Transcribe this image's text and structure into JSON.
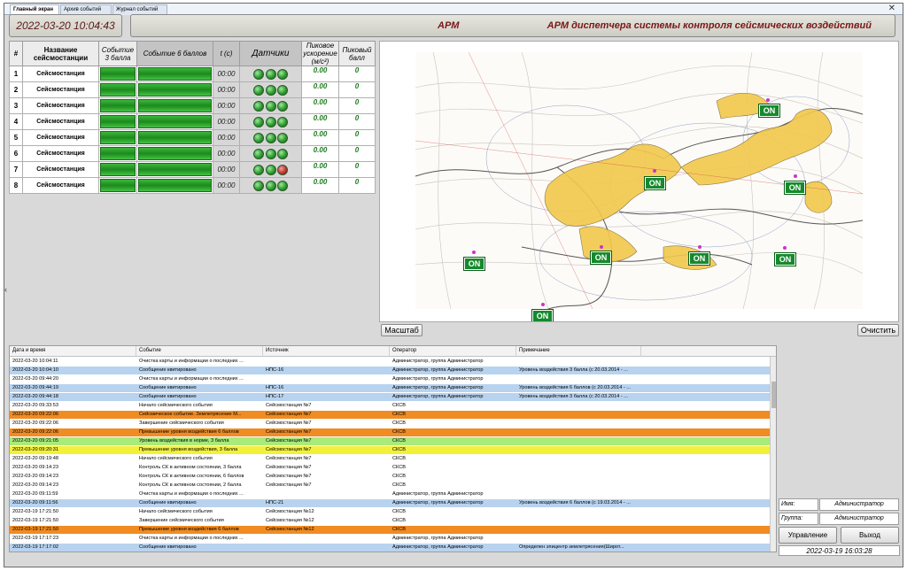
{
  "tabs": [
    "Главный экран",
    "Архив событий",
    "Журнал событий"
  ],
  "header": {
    "datetime": "2022-03-20 10:04:43",
    "left_label": "АРМ",
    "title": "АРМ диспетчера системы контроля сейсмических воздействий"
  },
  "stations_table": {
    "columns": {
      "num": "#",
      "name": "Название сейсмостанции",
      "event3": "Событие 3 балла",
      "event6": "Событие 6 баллов",
      "t": "t (с)",
      "sensors": "Датчики",
      "peak_accel": "Пиковое ускорение (м/с²)",
      "peak_score": "Пиковый балл"
    },
    "rows": [
      {
        "num": "1",
        "name": "Сейсмостанция",
        "t": "00:00",
        "sensors": [
          "green",
          "green",
          "green"
        ],
        "peak_accel": "0.00",
        "peak_score": "0"
      },
      {
        "num": "2",
        "name": "Сейсмостанция",
        "t": "00:00",
        "sensors": [
          "green",
          "green",
          "green"
        ],
        "peak_accel": "0.00",
        "peak_score": "0"
      },
      {
        "num": "3",
        "name": "Сейсмостанция",
        "t": "00:00",
        "sensors": [
          "green",
          "green",
          "green"
        ],
        "peak_accel": "0.00",
        "peak_score": "0"
      },
      {
        "num": "4",
        "name": "Сейсмостанция",
        "t": "00:00",
        "sensors": [
          "green",
          "green",
          "green"
        ],
        "peak_accel": "0.00",
        "peak_score": "0"
      },
      {
        "num": "5",
        "name": "Сейсмостанция",
        "t": "00:00",
        "sensors": [
          "green",
          "green",
          "green"
        ],
        "peak_accel": "0.00",
        "peak_score": "0"
      },
      {
        "num": "6",
        "name": "Сейсмостанция",
        "t": "00:00",
        "sensors": [
          "green",
          "green",
          "green"
        ],
        "peak_accel": "0.00",
        "peak_score": "0"
      },
      {
        "num": "7",
        "name": "Сейсмостанция",
        "t": "00:00",
        "sensors": [
          "green",
          "green",
          "red"
        ],
        "peak_accel": "0.00",
        "peak_score": "0"
      },
      {
        "num": "8",
        "name": "Сейсмостанция",
        "t": "00:00",
        "sensors": [
          "green",
          "green",
          "green"
        ],
        "peak_accel": "0.00",
        "peak_score": "0"
      }
    ]
  },
  "map": {
    "station_badge": "ON",
    "scale_button": "Масштаб",
    "clear_button": "Очистить"
  },
  "events": {
    "columns": [
      "Дата и время",
      "Событие",
      "Источник",
      "Оператор",
      "Примечание"
    ],
    "rows": [
      {
        "t": "2022-03-20 10:04:11",
        "ev": "Очистка карты и информации о последних ...",
        "src": "",
        "op": "Администратор, группа Администратор",
        "note": "",
        "color": "#ffffff"
      },
      {
        "t": "2022-03-20 10:04:10",
        "ev": "Сообщение квитировано",
        "src": "НПС-16",
        "op": "Администратор, группа Администратор",
        "note": "Уровень воздействия 3 балла (с 20.03.2014 - ...",
        "color": "#b8d3ef"
      },
      {
        "t": "2022-03-20 09:44:20",
        "ev": "Очистка карты и информации о последних ...",
        "src": "",
        "op": "Администратор, группа Администратор",
        "note": "",
        "color": "#ffffff"
      },
      {
        "t": "2022-03-20 09:44:19",
        "ev": "Сообщение квитировано",
        "src": "НПС-16",
        "op": "Администратор, группа Администратор",
        "note": "Уровень воздействия 6 баллов (с 20.03.2014 - ...",
        "color": "#b8d3ef"
      },
      {
        "t": "2022-03-20 09:44:18",
        "ev": "Сообщение квитировано",
        "src": "НПС-17",
        "op": "Администратор, группа Администратор",
        "note": "Уровень воздействия 3 балла (с 20.03.2014 - ...",
        "color": "#b8d3ef"
      },
      {
        "t": "2022-03-20 09:33:53",
        "ev": "Начало сейсмического события",
        "src": "Сейсмостанция №7",
        "op": "СКСВ",
        "note": "",
        "color": "#ffffff"
      },
      {
        "t": "2022-03-20 09:22:06",
        "ev": "Сейсмическое событие. Землетрясение М...",
        "src": "Сейсмостанция №7",
        "op": "СКСВ",
        "note": "",
        "color": "#f08c22"
      },
      {
        "t": "2022-03-20 09:22:06",
        "ev": "Завершение сейсмического события",
        "src": "Сейсмостанция №7",
        "op": "СКСВ",
        "note": "",
        "color": "#ffffff"
      },
      {
        "t": "2022-03-20 09:22:06",
        "ev": "Превышение уровня воздействия 6 баллов",
        "src": "Сейсмостанция №7",
        "op": "СКСВ",
        "note": "",
        "color": "#f08c22"
      },
      {
        "t": "2022-03-20 09:21:05",
        "ev": "Уровень воздействия в норме, 3 балла",
        "src": "Сейсмостанция №7",
        "op": "СКСВ",
        "note": "",
        "color": "#a8ea7c"
      },
      {
        "t": "2022-03-20 09:20:31",
        "ev": "Превышение уровня воздействия, 3 балла",
        "src": "Сейсмостанция №7",
        "op": "СКСВ",
        "note": "",
        "color": "#f3f03a"
      },
      {
        "t": "2022-03-20 09:19:48",
        "ev": "Начало сейсмического события",
        "src": "Сейсмостанция №7",
        "op": "СКСВ",
        "note": "",
        "color": "#ffffff"
      },
      {
        "t": "2022-03-20 09:14:23",
        "ev": "Контроль СК в активном состоянии, 3 балла",
        "src": "Сейсмостанция №7",
        "op": "СКСВ",
        "note": "",
        "color": "#ffffff"
      },
      {
        "t": "2022-03-20 09:14:23",
        "ev": "Контроль СК в активном состоянии, 6 баллов",
        "src": "Сейсмостанция №7",
        "op": "СКСВ",
        "note": "",
        "color": "#ffffff"
      },
      {
        "t": "2022-03-20 09:14:23",
        "ev": "Контроль СК в активном состоянии, 2 балла",
        "src": "Сейсмостанция №7",
        "op": "СКСВ",
        "note": "",
        "color": "#ffffff"
      },
      {
        "t": "2022-03-20 09:11:59",
        "ev": "Очистка карты и информации о последних ...",
        "src": "",
        "op": "Администратор, группа Администратор",
        "note": "",
        "color": "#ffffff"
      },
      {
        "t": "2022-03-20 09:11:56",
        "ev": "Сообщение квитировано",
        "src": "НПС-21",
        "op": "Администратор, группа Администратор",
        "note": "Уровень воздействия 6 баллов (с 19.03.2014 - ...",
        "color": "#b8d3ef"
      },
      {
        "t": "2022-03-19 17:21:50",
        "ev": "Начало сейсмического события",
        "src": "Сейсмостанция №12",
        "op": "СКСВ",
        "note": "",
        "color": "#ffffff"
      },
      {
        "t": "2022-03-19 17:21:50",
        "ev": "Завершение сейсмического события",
        "src": "Сейсмостанция №12",
        "op": "СКСВ",
        "note": "",
        "color": "#ffffff"
      },
      {
        "t": "2022-03-19 17:21:50",
        "ev": "Превышение уровня воздействия 6 баллов",
        "src": "Сейсмостанция №12",
        "op": "СКСВ",
        "note": "",
        "color": "#f08c22"
      },
      {
        "t": "2022-03-19 17:17:23",
        "ev": "Очистка карты и информации о последних ...",
        "src": "",
        "op": "Администратор, группа Администратор",
        "note": "",
        "color": "#ffffff"
      },
      {
        "t": "2022-03-19 17:17:02",
        "ev": "Сообщение квитировано",
        "src": "",
        "op": "Администратор, группа Администратор",
        "note": "Определен эпицентр землетрясения(Широт...",
        "color": "#b8d3ef"
      }
    ]
  },
  "user_panel": {
    "name_label": "Имя:",
    "name_value": "Администратор",
    "group_label": "Группа:",
    "group_value": "Администратор",
    "control_button": "Управление",
    "exit_button": "Выход",
    "timestamp": "2022-03-19 16:03:28"
  },
  "colors": {
    "ack": "#b8d3ef",
    "alarm": "#f08c22",
    "warning": "#f3f03a",
    "normal": "#a8ea7c",
    "station_on": "#158a2c"
  }
}
